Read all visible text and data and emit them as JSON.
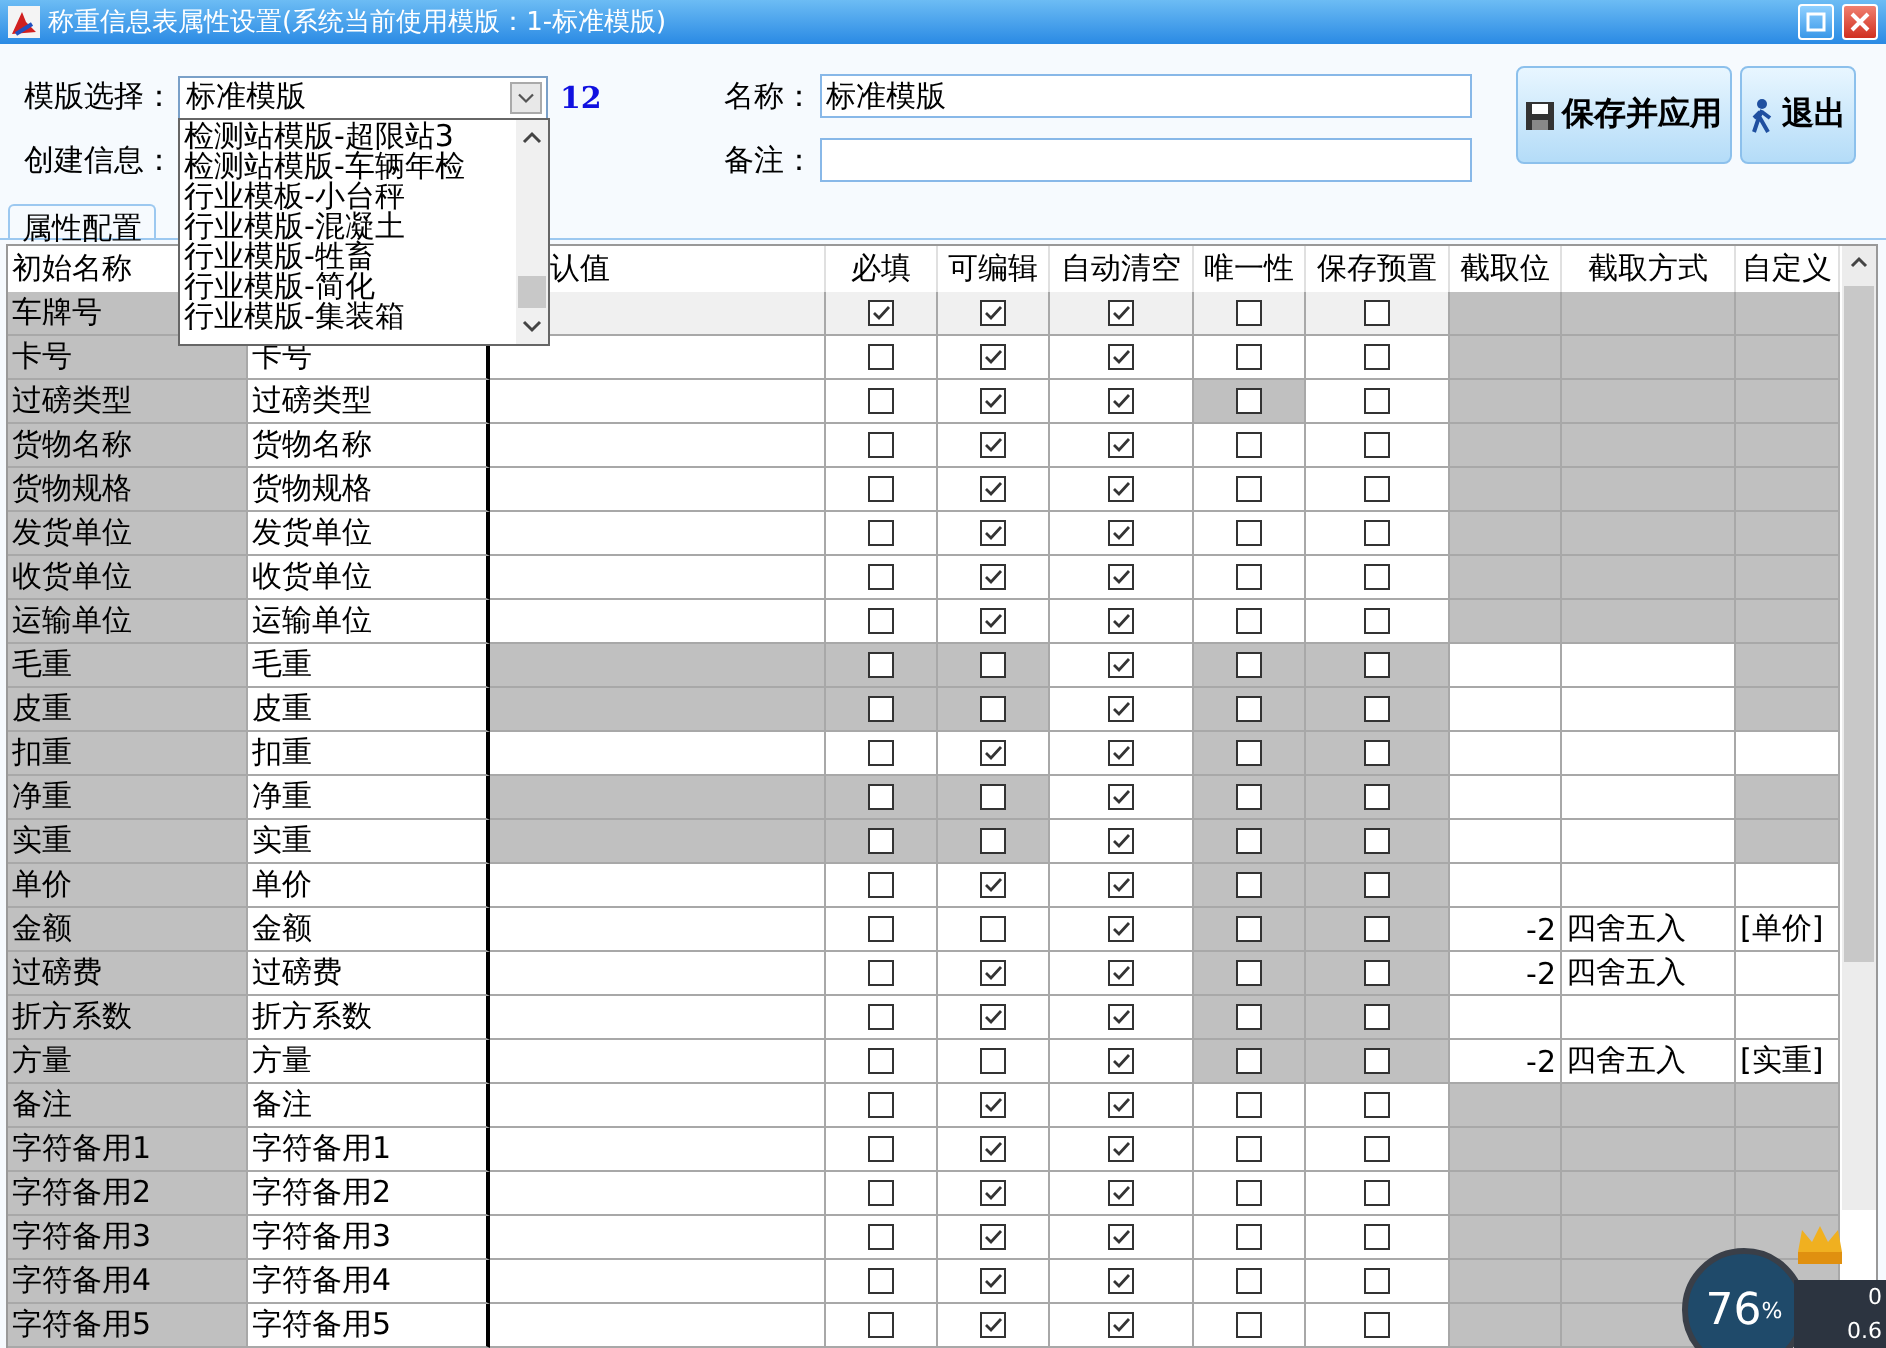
{
  "window": {
    "title": "称重信息表属性设置(系统当前使用模版：1-标准模版)"
  },
  "form": {
    "template_label": "模版选择：",
    "template_value": "标准模版",
    "count": "12",
    "name_label": "名称：",
    "name_value": "标准模版",
    "created_label": "创建信息：",
    "remark_label": "备注："
  },
  "dropdown": {
    "items": [
      "检测站模版-超限站3",
      "检测站模版-车辆年检",
      "行业模板-小台秤",
      "行业模版-混凝土",
      "行业模版-牲畜",
      "行业模版-简化",
      "行业模版-集装箱"
    ]
  },
  "buttons": [
    {
      "kind": "save",
      "label": "保存并应用"
    },
    {
      "kind": "exit",
      "label": "退出"
    }
  ],
  "tabs": [
    {
      "label": "属性配置",
      "selected": true
    }
  ],
  "table": {
    "columns": [
      "初始名称",
      null,
      "认值",
      "必填",
      "可编辑",
      "自动清空",
      "唯一性",
      "保存预置",
      "截取位",
      "截取方式",
      "自定义"
    ],
    "rows": [
      {
        "initial": "车牌号",
        "selected": true,
        "default_disabled": false,
        "flags": [
          {
            "checked": true,
            "disabled": false
          },
          {
            "checked": true,
            "disabled": false
          },
          {
            "checked": true,
            "disabled": false
          },
          {
            "checked": false,
            "disabled": false
          },
          {
            "checked": false,
            "disabled": false
          }
        ],
        "extra": [
          {
            "disabled": true
          },
          {
            "disabled": true
          },
          {
            "disabled": true
          }
        ]
      },
      {
        "initial": "卡号",
        "display": "卡号",
        "selected": false,
        "default_disabled": false,
        "flags": [
          {
            "checked": false,
            "disabled": false
          },
          {
            "checked": true,
            "disabled": false
          },
          {
            "checked": true,
            "disabled": false
          },
          {
            "checked": false,
            "disabled": false
          },
          {
            "checked": false,
            "disabled": false
          }
        ],
        "extra": [
          {
            "disabled": true
          },
          {
            "disabled": true
          },
          {
            "disabled": true
          }
        ]
      },
      {
        "initial": "过磅类型",
        "display": "过磅类型",
        "selected": false,
        "default_disabled": false,
        "flags": [
          {
            "checked": false,
            "disabled": false
          },
          {
            "checked": true,
            "disabled": false
          },
          {
            "checked": true,
            "disabled": false
          },
          {
            "checked": false,
            "disabled": true
          },
          {
            "checked": false,
            "disabled": false
          }
        ],
        "extra": [
          {
            "disabled": true
          },
          {
            "disabled": true
          },
          {
            "disabled": true
          }
        ]
      },
      {
        "initial": "货物名称",
        "display": "货物名称",
        "selected": false,
        "default_disabled": false,
        "flags": [
          {
            "checked": false,
            "disabled": false
          },
          {
            "checked": true,
            "disabled": false
          },
          {
            "checked": true,
            "disabled": false
          },
          {
            "checked": false,
            "disabled": false
          },
          {
            "checked": false,
            "disabled": false
          }
        ],
        "extra": [
          {
            "disabled": true
          },
          {
            "disabled": true
          },
          {
            "disabled": true
          }
        ]
      },
      {
        "initial": "货物规格",
        "display": "货物规格",
        "selected": false,
        "default_disabled": false,
        "flags": [
          {
            "checked": false,
            "disabled": false
          },
          {
            "checked": true,
            "disabled": false
          },
          {
            "checked": true,
            "disabled": false
          },
          {
            "checked": false,
            "disabled": false
          },
          {
            "checked": false,
            "disabled": false
          }
        ],
        "extra": [
          {
            "disabled": true
          },
          {
            "disabled": true
          },
          {
            "disabled": true
          }
        ]
      },
      {
        "initial": "发货单位",
        "display": "发货单位",
        "selected": false,
        "default_disabled": false,
        "flags": [
          {
            "checked": false,
            "disabled": false
          },
          {
            "checked": true,
            "disabled": false
          },
          {
            "checked": true,
            "disabled": false
          },
          {
            "checked": false,
            "disabled": false
          },
          {
            "checked": false,
            "disabled": false
          }
        ],
        "extra": [
          {
            "disabled": true
          },
          {
            "disabled": true
          },
          {
            "disabled": true
          }
        ]
      },
      {
        "initial": "收货单位",
        "display": "收货单位",
        "selected": false,
        "default_disabled": false,
        "flags": [
          {
            "checked": false,
            "disabled": false
          },
          {
            "checked": true,
            "disabled": false
          },
          {
            "checked": true,
            "disabled": false
          },
          {
            "checked": false,
            "disabled": false
          },
          {
            "checked": false,
            "disabled": false
          }
        ],
        "extra": [
          {
            "disabled": true
          },
          {
            "disabled": true
          },
          {
            "disabled": true
          }
        ]
      },
      {
        "initial": "运输单位",
        "display": "运输单位",
        "selected": false,
        "default_disabled": false,
        "flags": [
          {
            "checked": false,
            "disabled": false
          },
          {
            "checked": true,
            "disabled": false
          },
          {
            "checked": true,
            "disabled": false
          },
          {
            "checked": false,
            "disabled": false
          },
          {
            "checked": false,
            "disabled": false
          }
        ],
        "extra": [
          {
            "disabled": true
          },
          {
            "disabled": true
          },
          {
            "disabled": true
          }
        ]
      },
      {
        "initial": "毛重",
        "display": "毛重",
        "selected": false,
        "default_disabled": true,
        "flags": [
          {
            "checked": false,
            "disabled": true
          },
          {
            "checked": false,
            "disabled": true
          },
          {
            "checked": true,
            "disabled": false
          },
          {
            "checked": false,
            "disabled": true
          },
          {
            "checked": false,
            "disabled": true
          }
        ],
        "extra": [
          {
            "disabled": false
          },
          {
            "disabled": false
          },
          {
            "disabled": true
          }
        ]
      },
      {
        "initial": "皮重",
        "display": "皮重",
        "selected": false,
        "default_disabled": true,
        "flags": [
          {
            "checked": false,
            "disabled": true
          },
          {
            "checked": false,
            "disabled": true
          },
          {
            "checked": true,
            "disabled": false
          },
          {
            "checked": false,
            "disabled": true
          },
          {
            "checked": false,
            "disabled": true
          }
        ],
        "extra": [
          {
            "disabled": false
          },
          {
            "disabled": false
          },
          {
            "disabled": true
          }
        ]
      },
      {
        "initial": "扣重",
        "display": "扣重",
        "selected": false,
        "default_disabled": false,
        "flags": [
          {
            "checked": false,
            "disabled": false
          },
          {
            "checked": true,
            "disabled": false
          },
          {
            "checked": true,
            "disabled": false
          },
          {
            "checked": false,
            "disabled": true
          },
          {
            "checked": false,
            "disabled": true
          }
        ],
        "extra": [
          {
            "disabled": false
          },
          {
            "disabled": false
          },
          {
            "disabled": false
          }
        ]
      },
      {
        "initial": "净重",
        "display": "净重",
        "selected": false,
        "default_disabled": true,
        "flags": [
          {
            "checked": false,
            "disabled": true
          },
          {
            "checked": false,
            "disabled": true
          },
          {
            "checked": true,
            "disabled": false
          },
          {
            "checked": false,
            "disabled": true
          },
          {
            "checked": false,
            "disabled": true
          }
        ],
        "extra": [
          {
            "disabled": false
          },
          {
            "disabled": false
          },
          {
            "disabled": true
          }
        ]
      },
      {
        "initial": "实重",
        "display": "实重",
        "selected": false,
        "default_disabled": true,
        "flags": [
          {
            "checked": false,
            "disabled": true
          },
          {
            "checked": false,
            "disabled": true
          },
          {
            "checked": true,
            "disabled": false
          },
          {
            "checked": false,
            "disabled": true
          },
          {
            "checked": false,
            "disabled": true
          }
        ],
        "extra": [
          {
            "disabled": false
          },
          {
            "disabled": false
          },
          {
            "disabled": true
          }
        ]
      },
      {
        "initial": "单价",
        "display": "单价",
        "selected": false,
        "default_disabled": false,
        "flags": [
          {
            "checked": false,
            "disabled": false
          },
          {
            "checked": true,
            "disabled": false
          },
          {
            "checked": true,
            "disabled": false
          },
          {
            "checked": false,
            "disabled": true
          },
          {
            "checked": false,
            "disabled": true
          }
        ],
        "extra": [
          {
            "disabled": false
          },
          {
            "disabled": false
          },
          {
            "disabled": false
          }
        ]
      },
      {
        "initial": "金额",
        "display": "金额",
        "selected": false,
        "default_disabled": false,
        "flags": [
          {
            "checked": false,
            "disabled": false
          },
          {
            "checked": false,
            "disabled": false
          },
          {
            "checked": true,
            "disabled": false
          },
          {
            "checked": false,
            "disabled": true
          },
          {
            "checked": false,
            "disabled": true
          }
        ],
        "extra": [
          {
            "text": "-2",
            "disabled": false
          },
          {
            "text": "四舍五入",
            "disabled": false
          },
          {
            "text": "[单价]",
            "disabled": false
          }
        ]
      },
      {
        "initial": "过磅费",
        "display": "过磅费",
        "selected": false,
        "default_disabled": false,
        "flags": [
          {
            "checked": false,
            "disabled": false
          },
          {
            "checked": true,
            "disabled": false
          },
          {
            "checked": true,
            "disabled": false
          },
          {
            "checked": false,
            "disabled": true
          },
          {
            "checked": false,
            "disabled": true
          }
        ],
        "extra": [
          {
            "text": "-2",
            "disabled": false
          },
          {
            "text": "四舍五入",
            "disabled": false
          },
          {
            "disabled": false
          }
        ]
      },
      {
        "initial": "折方系数",
        "display": "折方系数",
        "selected": false,
        "default_disabled": false,
        "flags": [
          {
            "checked": false,
            "disabled": false
          },
          {
            "checked": true,
            "disabled": false
          },
          {
            "checked": true,
            "disabled": false
          },
          {
            "checked": false,
            "disabled": true
          },
          {
            "checked": false,
            "disabled": true
          }
        ],
        "extra": [
          {
            "disabled": false
          },
          {
            "disabled": false
          },
          {
            "disabled": false
          }
        ]
      },
      {
        "initial": "方量",
        "display": "方量",
        "selected": false,
        "default_disabled": false,
        "flags": [
          {
            "checked": false,
            "disabled": false
          },
          {
            "checked": false,
            "disabled": false
          },
          {
            "checked": true,
            "disabled": false
          },
          {
            "checked": false,
            "disabled": true
          },
          {
            "checked": false,
            "disabled": true
          }
        ],
        "extra": [
          {
            "text": "-2",
            "disabled": false
          },
          {
            "text": "四舍五入",
            "disabled": false
          },
          {
            "text": "[实重]",
            "disabled": false
          }
        ]
      },
      {
        "initial": "备注",
        "display": "备注",
        "selected": false,
        "default_disabled": false,
        "flags": [
          {
            "checked": false,
            "disabled": false
          },
          {
            "checked": true,
            "disabled": false
          },
          {
            "checked": true,
            "disabled": false
          },
          {
            "checked": false,
            "disabled": false
          },
          {
            "checked": false,
            "disabled": false
          }
        ],
        "extra": [
          {
            "disabled": true
          },
          {
            "disabled": true
          },
          {
            "disabled": true
          }
        ]
      },
      {
        "initial": "字符备用1",
        "display": "字符备用1",
        "selected": false,
        "default_disabled": false,
        "flags": [
          {
            "checked": false,
            "disabled": false
          },
          {
            "checked": true,
            "disabled": false
          },
          {
            "checked": true,
            "disabled": false
          },
          {
            "checked": false,
            "disabled": false
          },
          {
            "checked": false,
            "disabled": false
          }
        ],
        "extra": [
          {
            "disabled": true
          },
          {
            "disabled": true
          },
          {
            "disabled": true
          }
        ]
      },
      {
        "initial": "字符备用2",
        "display": "字符备用2",
        "selected": false,
        "default_disabled": false,
        "flags": [
          {
            "checked": false,
            "disabled": false
          },
          {
            "checked": true,
            "disabled": false
          },
          {
            "checked": true,
            "disabled": false
          },
          {
            "checked": false,
            "disabled": false
          },
          {
            "checked": false,
            "disabled": false
          }
        ],
        "extra": [
          {
            "disabled": true
          },
          {
            "disabled": true
          },
          {
            "disabled": true
          }
        ]
      },
      {
        "initial": "字符备用3",
        "display": "字符备用3",
        "selected": false,
        "default_disabled": false,
        "flags": [
          {
            "checked": false,
            "disabled": false
          },
          {
            "checked": true,
            "disabled": false
          },
          {
            "checked": true,
            "disabled": false
          },
          {
            "checked": false,
            "disabled": false
          },
          {
            "checked": false,
            "disabled": false
          }
        ],
        "extra": [
          {
            "disabled": true
          },
          {
            "disabled": true
          },
          {
            "disabled": true
          }
        ]
      },
      {
        "initial": "字符备用4",
        "display": "字符备用4",
        "selected": false,
        "default_disabled": false,
        "flags": [
          {
            "checked": false,
            "disabled": false
          },
          {
            "checked": true,
            "disabled": false
          },
          {
            "checked": true,
            "disabled": false
          },
          {
            "checked": false,
            "disabled": false
          },
          {
            "checked": false,
            "disabled": false
          }
        ],
        "extra": [
          {
            "disabled": true
          },
          {
            "disabled": true
          },
          {
            "disabled": true
          }
        ]
      },
      {
        "initial": "字符备用5",
        "display": "字符备用5",
        "selected": false,
        "default_disabled": false,
        "flags": [
          {
            "checked": false,
            "disabled": false
          },
          {
            "checked": true,
            "disabled": false
          },
          {
            "checked": true,
            "disabled": false
          },
          {
            "checked": false,
            "disabled": false
          },
          {
            "checked": false,
            "disabled": false
          }
        ],
        "extra": [
          {
            "disabled": true
          },
          {
            "disabled": true
          }
        ]
      }
    ]
  },
  "monitor": {
    "percent": "76",
    "unit": "%",
    "upload": "0",
    "download": "0.6"
  }
}
